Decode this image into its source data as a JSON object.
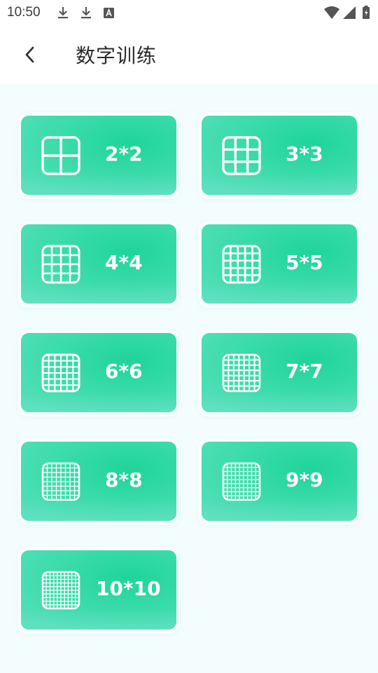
{
  "status_bar": {
    "time": "10:50",
    "icons": [
      "download-icon",
      "download-icon",
      "font-icon",
      "wifi-icon",
      "signal-icon",
      "battery-icon"
    ]
  },
  "header": {
    "back_icon": "chevron-left-icon",
    "title": "数字训练"
  },
  "tiles": [
    {
      "label": "2*2",
      "grid": 2
    },
    {
      "label": "3*3",
      "grid": 3
    },
    {
      "label": "4*4",
      "grid": 4
    },
    {
      "label": "5*5",
      "grid": 5
    },
    {
      "label": "6*6",
      "grid": 6
    },
    {
      "label": "7*7",
      "grid": 7
    },
    {
      "label": "8*8",
      "grid": 8
    },
    {
      "label": "9*9",
      "grid": 9
    },
    {
      "label": "10*10",
      "grid": 10
    }
  ],
  "colors": {
    "tile_gradient_start": "#1fd49a",
    "tile_gradient_end": "#5ae0bb",
    "content_background": "#f4fdfd"
  }
}
